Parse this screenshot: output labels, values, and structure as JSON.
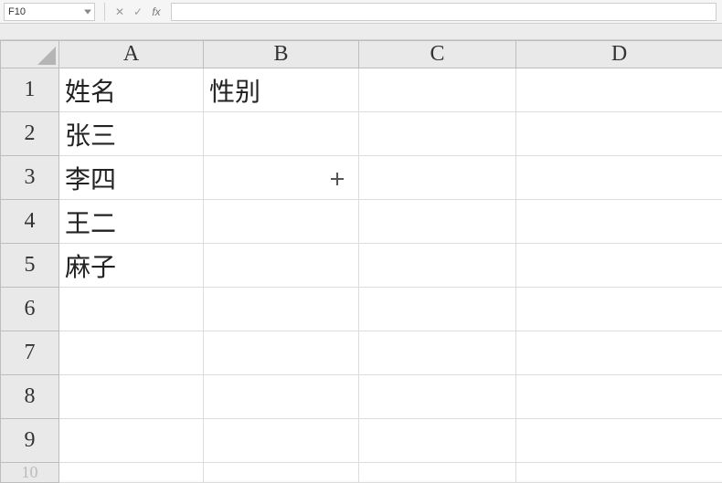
{
  "formula_bar": {
    "name_box_value": "F10",
    "cancel_glyph": "✕",
    "confirm_glyph": "✓",
    "fx_label": "fx",
    "formula_value": ""
  },
  "columns": [
    "A",
    "B",
    "C",
    "D"
  ],
  "rows": [
    "1",
    "2",
    "3",
    "4",
    "5",
    "6",
    "7",
    "8",
    "9"
  ],
  "partial_row": "10",
  "cells": {
    "A1": "姓名",
    "B1": "性别",
    "A2": "张三",
    "A3": "李四",
    "A4": "王二",
    "A5": "麻子"
  }
}
